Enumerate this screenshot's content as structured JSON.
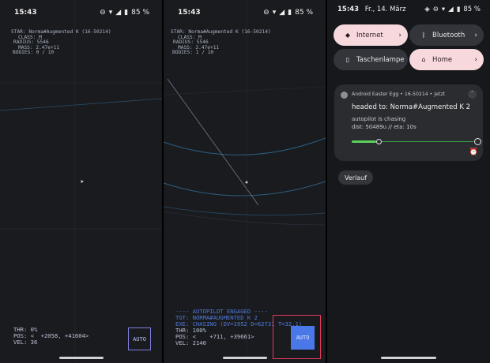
{
  "screen1": {
    "status": {
      "time": "15:43",
      "battery": "85 %"
    },
    "star_info": [
      "STAR: Norma#Augmented K (16-50214)",
      "CLASS: M",
      "RADIUS: 5546",
      "MASS: 2.47e+11",
      "BODIES: 0 / 10"
    ],
    "hud": {
      "thr": "THR: 0%",
      "pos": "POS: <  +2058, +41604>",
      "vel": "VEL: 36"
    },
    "auto_label": "AUTO"
  },
  "screen2": {
    "status": {
      "time": "15:43",
      "battery": "85 %"
    },
    "star_info": [
      "STAR: Norma#Augmented K (16-50214)",
      "CLASS: M",
      "RADIUS: 5546",
      "MASS: 2.47e+11",
      "BODIES: 1 / 10"
    ],
    "autopilot": [
      "---- AUTOPILOT ENGAGED ----",
      "TGT: NORMA#AUGMENTED K 2",
      "EXE: CHASING (DV=1952 D=62731 T=32.1)"
    ],
    "hud": {
      "thr": "THR: 100%",
      "pos": "POS: <    +711, +39661>",
      "vel": "VEL: 2140"
    },
    "auto_label": "AUTO"
  },
  "screen3": {
    "time": "15:43",
    "date": "Fr., 14. März",
    "battery": "85 %",
    "tiles": [
      {
        "label": "Internet",
        "icon": "wifi-icon",
        "state": "on"
      },
      {
        "label": "Bluetooth",
        "icon": "bluetooth-icon",
        "state": "off"
      },
      {
        "label": "Taschenlampe",
        "icon": "flashlight-icon",
        "state": "off"
      },
      {
        "label": "Home",
        "icon": "home-icon",
        "state": "on"
      }
    ],
    "notification": {
      "app": "Android Easter Egg • 16-50214 • Jetzt",
      "title": "headed to: Norma#Augmented K 2",
      "line1": "autopilot is chasing",
      "line2": "dist: 50489u // eta: 10s",
      "progress": 0.2
    },
    "history_button": "Verlauf"
  },
  "colors": {
    "accent_blue": "#4f7bd8",
    "notif_green": "#5ad15a",
    "tile_on": "#f6d8dd",
    "highlight_red": "#e03a5a"
  }
}
